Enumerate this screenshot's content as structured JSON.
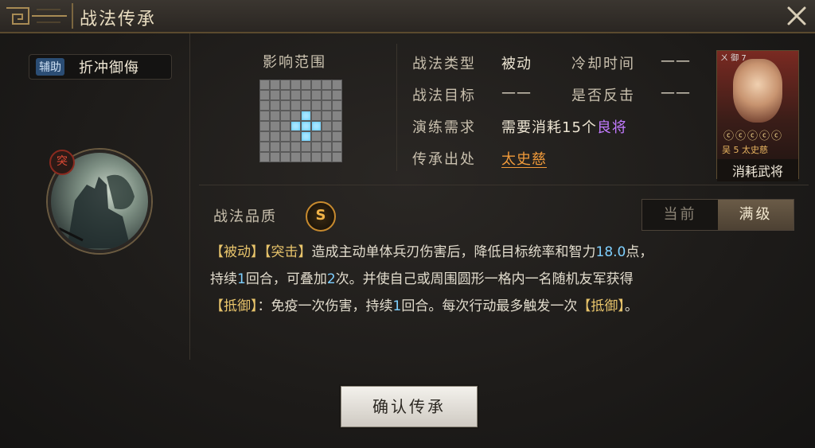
{
  "window": {
    "title": "战法传承"
  },
  "skill": {
    "type_tag": "辅助",
    "name": "折冲御侮",
    "icon_badge": "突"
  },
  "range": {
    "label": "影响范围",
    "cells_on": [
      [
        3,
        4
      ],
      [
        4,
        3
      ],
      [
        4,
        4
      ],
      [
        4,
        5
      ],
      [
        5,
        4
      ]
    ]
  },
  "info": {
    "type_label": "战法类型",
    "type_value": "被动",
    "cooldown_label": "冷却时间",
    "cooldown_value": "——",
    "target_label": "战法目标",
    "target_value": "——",
    "counter_label": "是否反击",
    "counter_value": "——",
    "train_label": "演练需求",
    "train_prefix": "需要消耗",
    "train_count": "15",
    "train_unit": "个",
    "train_item": "良将",
    "source_label": "传承出处",
    "source_value": "太史慈"
  },
  "portrait": {
    "corner_text": "ㄨ 御 7",
    "stars": "ⓒⓒⓒⓒⓒ",
    "info_line": "吴 5 太史慈",
    "tag": "消耗武将"
  },
  "quality": {
    "label": "战法品质",
    "grade": "S"
  },
  "toggle": {
    "current": "当前",
    "max": "满级"
  },
  "description": {
    "line1_a": "【被动】",
    "line1_b": "【突击】",
    "line1_c": "造成主动单体兵刃伤害后，降低目标统率和智力",
    "line1_num": "18.0",
    "line1_d": "点，",
    "line2_a": "持续",
    "line2_n1": "1",
    "line2_b": "回合，可叠加",
    "line2_n2": "2",
    "line2_c": "次。并使自己或周围圆形一格内一名随机友军获得",
    "line3_a": "【抵御】",
    "line3_b": "：免疫一次伤害，持续",
    "line3_n": "1",
    "line3_c": "回合。每次行动最多触发一次",
    "line3_d": "【抵御】",
    "line3_e": "。"
  },
  "confirm_label": "确认传承"
}
